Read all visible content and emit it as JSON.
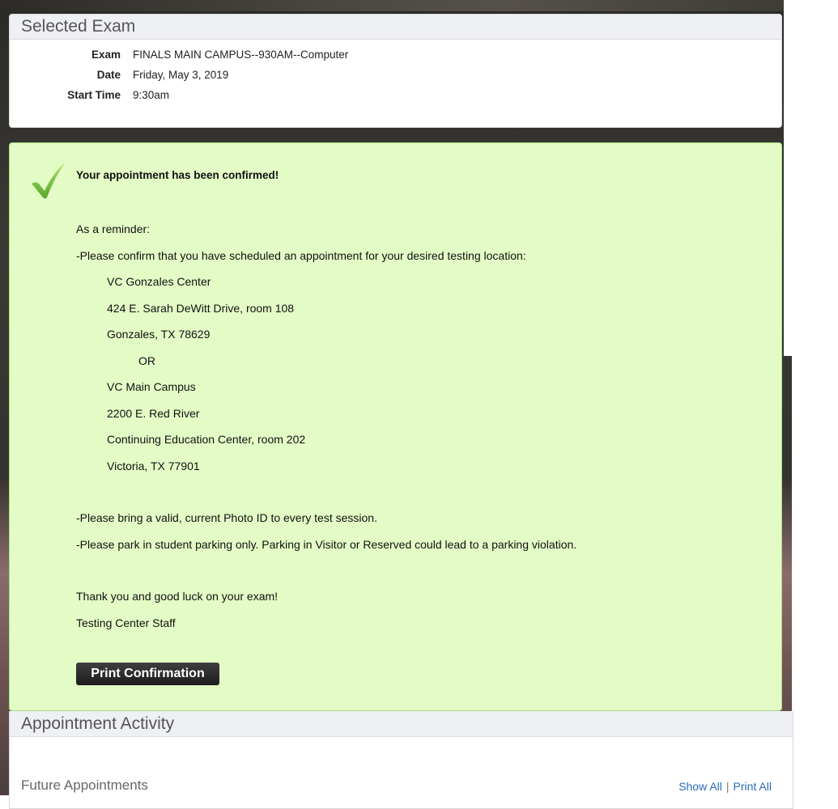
{
  "selected_exam": {
    "title": "Selected Exam",
    "rows": [
      {
        "label": "Exam",
        "value": "FINALS MAIN CAMPUS--930AM--Computer"
      },
      {
        "label": "Date",
        "value": "Friday, May 3, 2019"
      },
      {
        "label": "Start Time",
        "value": "9:30am"
      }
    ]
  },
  "confirmation": {
    "headline": "Your appointment has been confirmed!",
    "reminder": "As a reminder:",
    "confirm_location": "-Please confirm that you have scheduled an appointment for your desired testing location:",
    "location1": {
      "name": "VC Gonzales Center",
      "address": "424 E. Sarah DeWitt Drive, room 108",
      "city": "Gonzales, TX 78629"
    },
    "or": "OR",
    "location2": {
      "name": "VC Main Campus",
      "address": "2200 E. Red River",
      "building": "Continuing Education Center, room 202",
      "city": "Victoria, TX 77901"
    },
    "photo_id": "-Please bring a valid, current Photo ID to every test session.",
    "parking": "-Please park in student parking only. Parking in Visitor or Reserved could lead to a parking violation.",
    "thanks": "Thank you and good luck on your exam!",
    "signature": "Testing Center Staff",
    "print_label": "Print Confirmation"
  },
  "activity": {
    "title": "Appointment Activity",
    "future_label": "Future Appointments",
    "show_all": "Show All",
    "separator": "|",
    "print_all": "Print All"
  },
  "colors": {
    "confirm_bg": "#e3fcc6",
    "confirm_border": "#a6d985",
    "link": "#2a6ebb",
    "check": "#7cc242"
  }
}
